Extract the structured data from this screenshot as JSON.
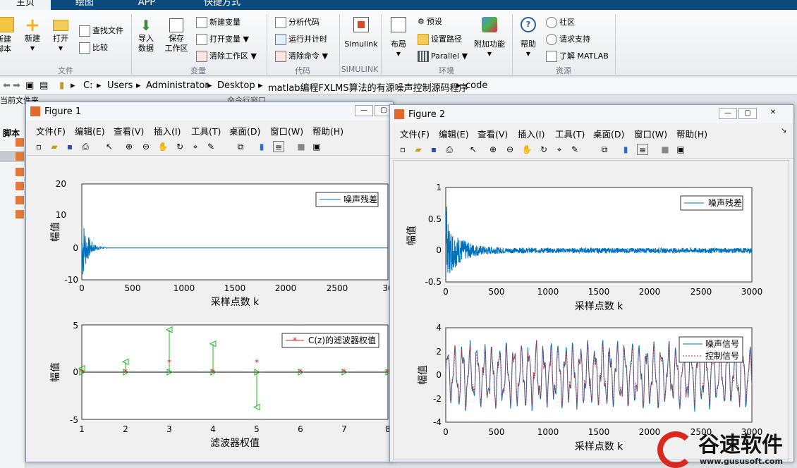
{
  "tabs": [
    {
      "label": "主页"
    },
    {
      "label": "绘图"
    },
    {
      "label": "APP"
    },
    {
      "label": "快捷方式"
    }
  ],
  "ribbon": {
    "file": {
      "new_script": "新建\n脚本",
      "new": "新建",
      "open": "打开",
      "find_files": "查找文件",
      "compare": "比较",
      "section": "文件"
    },
    "variable": {
      "import": "导入\n数据",
      "save": "保存\n工作区",
      "new_var": "新建变量",
      "open_var": "打开变量",
      "clear_ws": "清除工作区",
      "section": "变量"
    },
    "code": {
      "analyze": "分析代码",
      "run_time": "运行并计时",
      "clear_cmd": "清除命令",
      "section": "代码"
    },
    "simulink": {
      "label": "Simulink",
      "section": "SIMULINK"
    },
    "env": {
      "layout": "布局",
      "prefs": "预设",
      "setpath": "设置路径",
      "parallel": "Parallel",
      "addons": "附加功能",
      "section": "环境"
    },
    "res": {
      "help": "帮助",
      "community": "社区",
      "support": "请求支持",
      "learn": "了解 MATLAB",
      "section": "资源"
    }
  },
  "address": {
    "crumbs": [
      "C:",
      "Users",
      "Administrator",
      "Desktop",
      "matlab编程FXLMS算法的有源噪声控制源码程序",
      "code"
    ]
  },
  "left": {
    "current_folder": "当前文件夹",
    "script": "脚本",
    "cmd_window": "命令行窗口"
  },
  "menus": [
    "文件(F)",
    "编辑(E)",
    "查看(V)",
    "插入(I)",
    "工具(T)",
    "桌面(D)",
    "窗口(W)",
    "帮助(H)"
  ],
  "fig1": {
    "title": "Figure 1",
    "top": {
      "ylabel": "幅值",
      "xlabel": "采样点数 k",
      "legend": "噪声残差",
      "yticks": [
        "20",
        "10",
        "0",
        "-10"
      ],
      "xticks": [
        "0",
        "500",
        "1000",
        "1500",
        "2000",
        "2500",
        "30"
      ]
    },
    "bottom": {
      "ylabel": "幅值",
      "xlabel": "滤波器权值",
      "legend": "C(z)的滤波器权值",
      "yticks": [
        "5",
        "0",
        "-5"
      ],
      "xticks": [
        "1",
        "2",
        "3",
        "4",
        "5",
        "6",
        "7",
        "8"
      ]
    }
  },
  "fig2": {
    "title": "Figure 2",
    "top": {
      "ylabel": "幅值",
      "xlabel": "采样点数 k",
      "legend": "噪声残差",
      "yticks": [
        "1",
        "0.5",
        "0",
        "-0.5"
      ],
      "xticks": [
        "0",
        "500",
        "1000",
        "1500",
        "2000",
        "2500",
        "3000"
      ]
    },
    "bottom": {
      "ylabel": "幅值",
      "xlabel": "采样点数 k",
      "legend1": "噪声信号",
      "legend2": "控制信号",
      "yticks": [
        "4",
        "2",
        "0",
        "-2",
        "-4"
      ],
      "xticks": [
        "0",
        "500",
        "1000",
        "1500",
        "2000",
        "2500",
        "3000"
      ]
    }
  },
  "watermark": {
    "brand": "谷速软件",
    "url": "www.gususoft.com"
  },
  "chart_data": [
    {
      "type": "line",
      "ylabel": "幅值",
      "xlabel": "采样点数 k",
      "xlim": [
        0,
        3000
      ],
      "ylim": [
        -10,
        20
      ],
      "series": [
        {
          "name": "噪声残差",
          "x": [
            0,
            20,
            40,
            60,
            100,
            200,
            400,
            1000,
            3000
          ],
          "values": [
            0,
            12,
            -7,
            4,
            -2,
            0.5,
            0,
            0,
            0
          ]
        }
      ]
    },
    {
      "type": "scatter",
      "ylabel": "幅值",
      "xlabel": "滤波器权值",
      "xlim": [
        1,
        8
      ],
      "ylim": [
        -5,
        5
      ],
      "series": [
        {
          "name": "C(z)的滤波器权值",
          "x": [
            1,
            2,
            3,
            4,
            5,
            6,
            7,
            8
          ],
          "values": [
            0,
            0,
            1,
            0,
            1,
            0,
            0,
            0
          ]
        },
        {
          "x": [
            1,
            2,
            3,
            4,
            5,
            6,
            7,
            8
          ],
          "values": [
            0.4,
            1.1,
            4.5,
            3.0,
            -3.7,
            0,
            0,
            0
          ]
        }
      ]
    },
    {
      "type": "line",
      "ylabel": "幅值",
      "xlabel": "采样点数 k",
      "xlim": [
        0,
        3000
      ],
      "ylim": [
        -0.5,
        1
      ],
      "series": [
        {
          "name": "噪声残差",
          "x": [
            0,
            20,
            50,
            100,
            200,
            500,
            1000,
            2000,
            3000
          ],
          "values": [
            0.8,
            -0.3,
            0.3,
            0.2,
            0.1,
            0.05,
            0.03,
            0.02,
            0.02
          ]
        }
      ]
    },
    {
      "type": "line",
      "ylabel": "幅值",
      "xlabel": "采样点数 k",
      "xlim": [
        0,
        3000
      ],
      "ylim": [
        -4,
        4
      ],
      "series": [
        {
          "name": "噪声信号",
          "x": [
            0,
            3000
          ],
          "values": [
            0,
            0
          ]
        },
        {
          "name": "控制信号",
          "x": [
            0,
            3000
          ],
          "values": [
            0,
            0
          ]
        }
      ]
    }
  ]
}
